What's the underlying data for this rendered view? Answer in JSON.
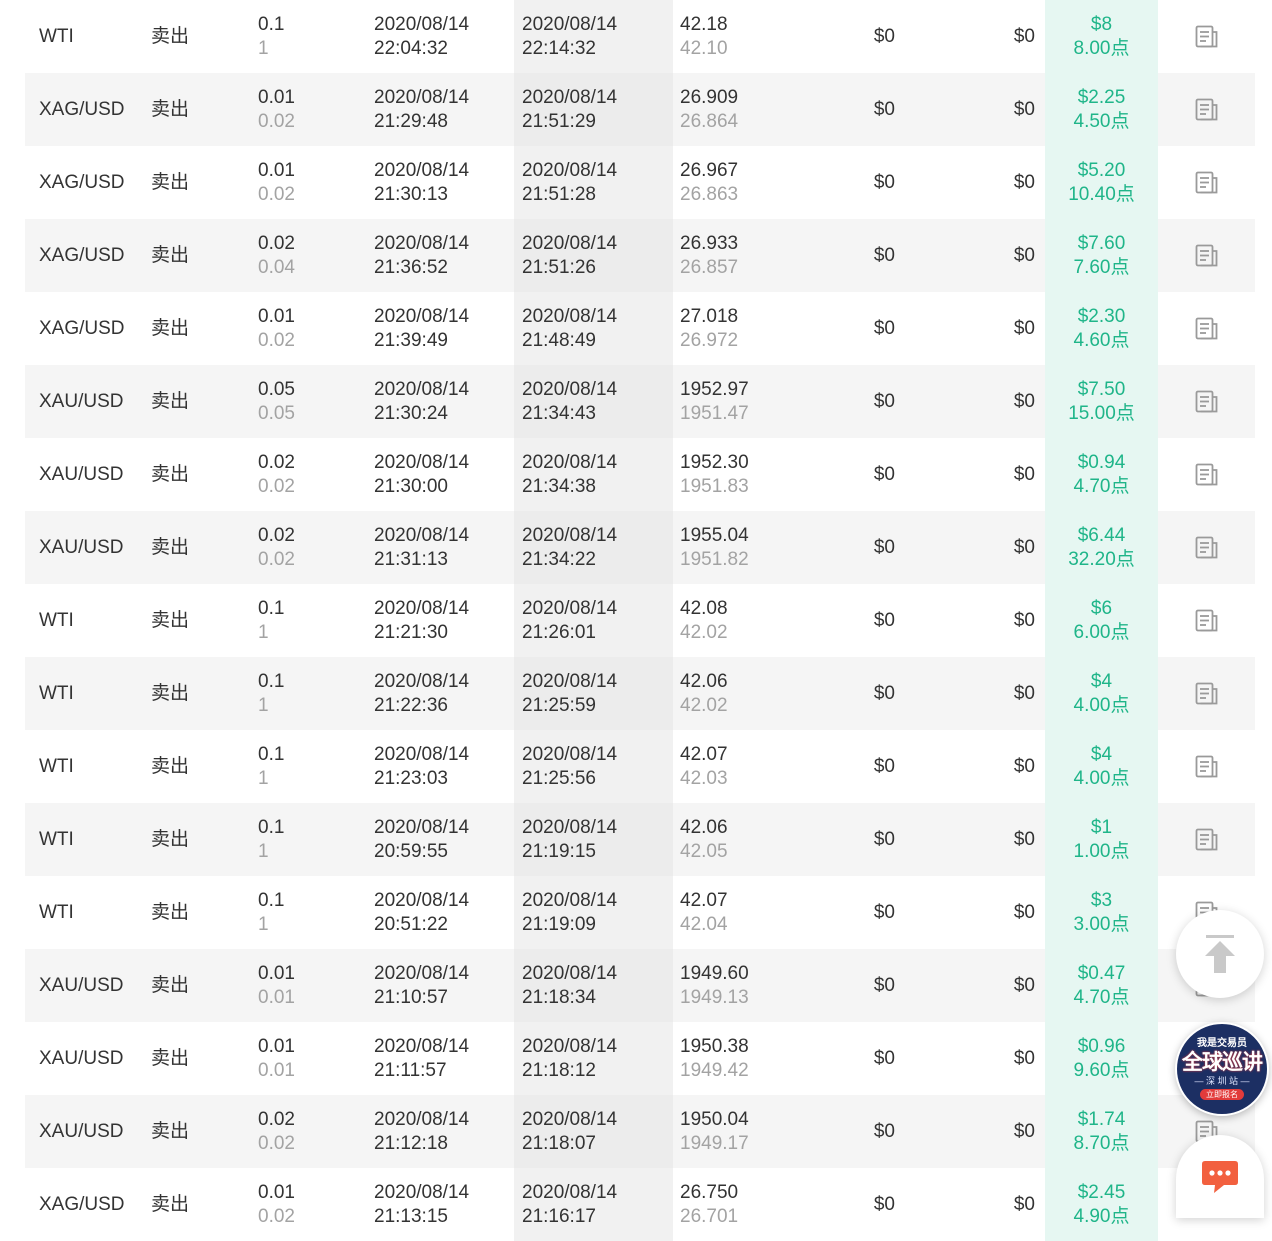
{
  "trades": [
    {
      "symbol": "WTI",
      "direction": "卖出",
      "lots": "0.1",
      "lots_sub": "1",
      "open_date": "2020/08/14",
      "open_time": "22:04:32",
      "close_date": "2020/08/14",
      "close_time": "22:14:32",
      "open_price": "42.18",
      "close_price": "42.10",
      "commission": "$0",
      "swap": "$0",
      "profit": "$8",
      "points": "8.00点"
    },
    {
      "symbol": "XAG/USD",
      "direction": "卖出",
      "lots": "0.01",
      "lots_sub": "0.02",
      "open_date": "2020/08/14",
      "open_time": "21:29:48",
      "close_date": "2020/08/14",
      "close_time": "21:51:29",
      "open_price": "26.909",
      "close_price": "26.864",
      "commission": "$0",
      "swap": "$0",
      "profit": "$2.25",
      "points": "4.50点"
    },
    {
      "symbol": "XAG/USD",
      "direction": "卖出",
      "lots": "0.01",
      "lots_sub": "0.02",
      "open_date": "2020/08/14",
      "open_time": "21:30:13",
      "close_date": "2020/08/14",
      "close_time": "21:51:28",
      "open_price": "26.967",
      "close_price": "26.863",
      "commission": "$0",
      "swap": "$0",
      "profit": "$5.20",
      "points": "10.40点"
    },
    {
      "symbol": "XAG/USD",
      "direction": "卖出",
      "lots": "0.02",
      "lots_sub": "0.04",
      "open_date": "2020/08/14",
      "open_time": "21:36:52",
      "close_date": "2020/08/14",
      "close_time": "21:51:26",
      "open_price": "26.933",
      "close_price": "26.857",
      "commission": "$0",
      "swap": "$0",
      "profit": "$7.60",
      "points": "7.60点"
    },
    {
      "symbol": "XAG/USD",
      "direction": "卖出",
      "lots": "0.01",
      "lots_sub": "0.02",
      "open_date": "2020/08/14",
      "open_time": "21:39:49",
      "close_date": "2020/08/14",
      "close_time": "21:48:49",
      "open_price": "27.018",
      "close_price": "26.972",
      "commission": "$0",
      "swap": "$0",
      "profit": "$2.30",
      "points": "4.60点"
    },
    {
      "symbol": "XAU/USD",
      "direction": "卖出",
      "lots": "0.05",
      "lots_sub": "0.05",
      "open_date": "2020/08/14",
      "open_time": "21:30:24",
      "close_date": "2020/08/14",
      "close_time": "21:34:43",
      "open_price": "1952.97",
      "close_price": "1951.47",
      "commission": "$0",
      "swap": "$0",
      "profit": "$7.50",
      "points": "15.00点"
    },
    {
      "symbol": "XAU/USD",
      "direction": "卖出",
      "lots": "0.02",
      "lots_sub": "0.02",
      "open_date": "2020/08/14",
      "open_time": "21:30:00",
      "close_date": "2020/08/14",
      "close_time": "21:34:38",
      "open_price": "1952.30",
      "close_price": "1951.83",
      "commission": "$0",
      "swap": "$0",
      "profit": "$0.94",
      "points": "4.70点"
    },
    {
      "symbol": "XAU/USD",
      "direction": "卖出",
      "lots": "0.02",
      "lots_sub": "0.02",
      "open_date": "2020/08/14",
      "open_time": "21:31:13",
      "close_date": "2020/08/14",
      "close_time": "21:34:22",
      "open_price": "1955.04",
      "close_price": "1951.82",
      "commission": "$0",
      "swap": "$0",
      "profit": "$6.44",
      "points": "32.20点"
    },
    {
      "symbol": "WTI",
      "direction": "卖出",
      "lots": "0.1",
      "lots_sub": "1",
      "open_date": "2020/08/14",
      "open_time": "21:21:30",
      "close_date": "2020/08/14",
      "close_time": "21:26:01",
      "open_price": "42.08",
      "close_price": "42.02",
      "commission": "$0",
      "swap": "$0",
      "profit": "$6",
      "points": "6.00点"
    },
    {
      "symbol": "WTI",
      "direction": "卖出",
      "lots": "0.1",
      "lots_sub": "1",
      "open_date": "2020/08/14",
      "open_time": "21:22:36",
      "close_date": "2020/08/14",
      "close_time": "21:25:59",
      "open_price": "42.06",
      "close_price": "42.02",
      "commission": "$0",
      "swap": "$0",
      "profit": "$4",
      "points": "4.00点"
    },
    {
      "symbol": "WTI",
      "direction": "卖出",
      "lots": "0.1",
      "lots_sub": "1",
      "open_date": "2020/08/14",
      "open_time": "21:23:03",
      "close_date": "2020/08/14",
      "close_time": "21:25:56",
      "open_price": "42.07",
      "close_price": "42.03",
      "commission": "$0",
      "swap": "$0",
      "profit": "$4",
      "points": "4.00点"
    },
    {
      "symbol": "WTI",
      "direction": "卖出",
      "lots": "0.1",
      "lots_sub": "1",
      "open_date": "2020/08/14",
      "open_time": "20:59:55",
      "close_date": "2020/08/14",
      "close_time": "21:19:15",
      "open_price": "42.06",
      "close_price": "42.05",
      "commission": "$0",
      "swap": "$0",
      "profit": "$1",
      "points": "1.00点"
    },
    {
      "symbol": "WTI",
      "direction": "卖出",
      "lots": "0.1",
      "lots_sub": "1",
      "open_date": "2020/08/14",
      "open_time": "20:51:22",
      "close_date": "2020/08/14",
      "close_time": "21:19:09",
      "open_price": "42.07",
      "close_price": "42.04",
      "commission": "$0",
      "swap": "$0",
      "profit": "$3",
      "points": "3.00点"
    },
    {
      "symbol": "XAU/USD",
      "direction": "卖出",
      "lots": "0.01",
      "lots_sub": "0.01",
      "open_date": "2020/08/14",
      "open_time": "21:10:57",
      "close_date": "2020/08/14",
      "close_time": "21:18:34",
      "open_price": "1949.60",
      "close_price": "1949.13",
      "commission": "$0",
      "swap": "$0",
      "profit": "$0.47",
      "points": "4.70点"
    },
    {
      "symbol": "XAU/USD",
      "direction": "卖出",
      "lots": "0.01",
      "lots_sub": "0.01",
      "open_date": "2020/08/14",
      "open_time": "21:11:57",
      "close_date": "2020/08/14",
      "close_time": "21:18:12",
      "open_price": "1950.38",
      "close_price": "1949.42",
      "commission": "$0",
      "swap": "$0",
      "profit": "$0.96",
      "points": "9.60点"
    },
    {
      "symbol": "XAU/USD",
      "direction": "卖出",
      "lots": "0.02",
      "lots_sub": "0.02",
      "open_date": "2020/08/14",
      "open_time": "21:12:18",
      "close_date": "2020/08/14",
      "close_time": "21:18:07",
      "open_price": "1950.04",
      "close_price": "1949.17",
      "commission": "$0",
      "swap": "$0",
      "profit": "$1.74",
      "points": "8.70点"
    },
    {
      "symbol": "XAG/USD",
      "direction": "卖出",
      "lots": "0.01",
      "lots_sub": "0.02",
      "open_date": "2020/08/14",
      "open_time": "21:13:15",
      "close_date": "2020/08/14",
      "close_time": "21:16:17",
      "open_price": "26.750",
      "close_price": "26.701",
      "commission": "$0",
      "swap": "$0",
      "profit": "$2.45",
      "points": "4.90点"
    }
  ],
  "icons": {
    "row_action": "detail-document-icon",
    "back_to_top": "arrow-up-to-top-icon",
    "chat": "chat-bubble-icon"
  },
  "promo": {
    "top": "我是交易员",
    "main": "全球巡讲",
    "sub": "— 深 圳 站 —",
    "cta": "立即报名"
  },
  "colors": {
    "profit_text": "#1fb589",
    "profit_bg": "#e6f7f2",
    "secondary_text": "#a3a3a3",
    "chat_accent": "#f2603f",
    "promo_bg": "#1c2f63"
  }
}
